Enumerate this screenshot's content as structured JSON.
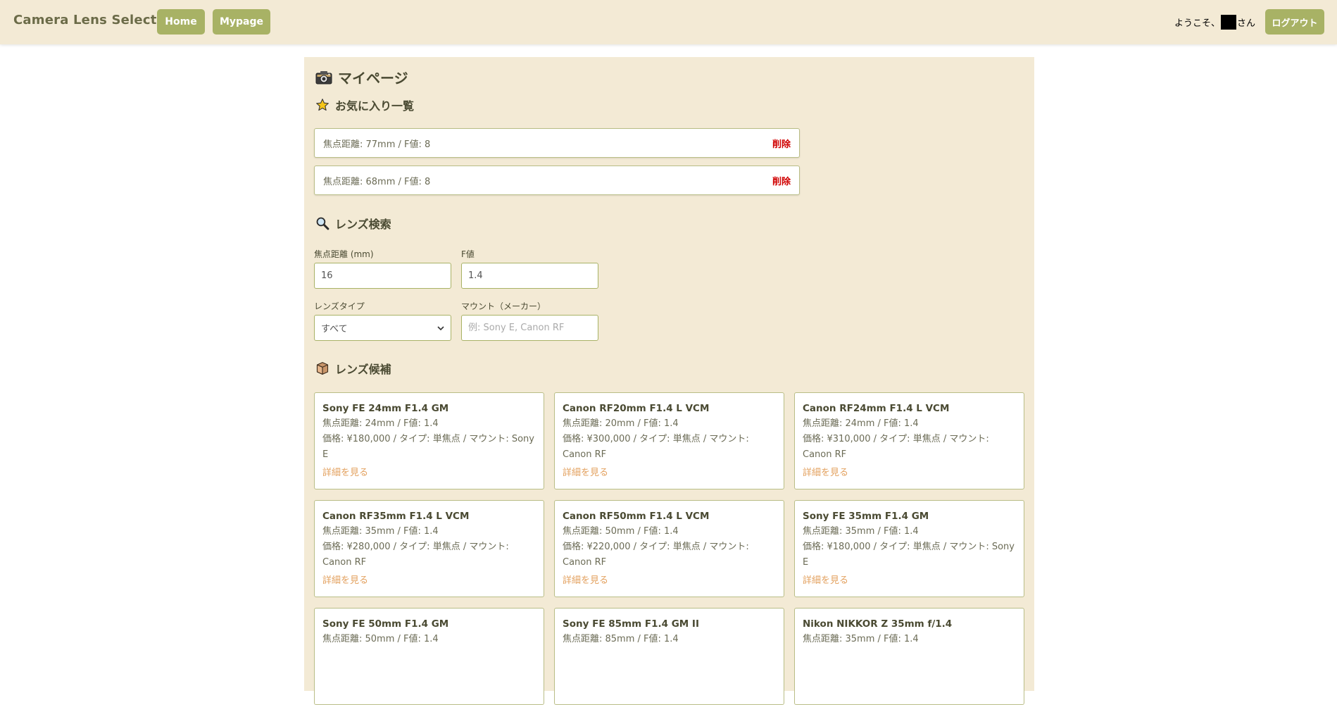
{
  "navbar": {
    "brand": "Camera Lens Selection",
    "home_label": "Home",
    "mypage_label": "Mypage",
    "welcome_prefix": "ようこそ、",
    "welcome_suffix": "さん",
    "logout_label": "ログアウト"
  },
  "mypage": {
    "title": "マイページ",
    "favorites_heading": "お気に入り一覧",
    "favorites": [
      {
        "text": "焦点距離: 77mm / F値: 8",
        "delete_label": "削除"
      },
      {
        "text": "焦点距離: 68mm / F値: 8",
        "delete_label": "削除"
      }
    ]
  },
  "search": {
    "heading": "レンズ検索",
    "focal_label": "焦点距離 (mm)",
    "focal_value": "16",
    "fvalue_label": "F値",
    "fvalue_value": "1.4",
    "type_label": "レンズタイプ",
    "type_selected": "すべて",
    "mount_label": "マウント（メーカー）",
    "mount_placeholder": "例: Sony E, Canon RF"
  },
  "candidates": {
    "heading": "レンズ候補",
    "detail_label": "詳細を見る",
    "cards": [
      {
        "name": "Sony FE 24mm F1.4 GM",
        "spec": "焦点距離: 24mm / F値: 1.4",
        "info": "価格: ¥180,000 / タイプ: 単焦点 / マウント: Sony E"
      },
      {
        "name": "Canon RF20mm F1.4 L VCM",
        "spec": "焦点距離: 20mm / F値: 1.4",
        "info": "価格: ¥300,000 / タイプ: 単焦点 / マウント: Canon RF"
      },
      {
        "name": "Canon RF24mm F1.4 L VCM",
        "spec": "焦点距離: 24mm / F値: 1.4",
        "info": "価格: ¥310,000 / タイプ: 単焦点 / マウント: Canon RF"
      },
      {
        "name": "Canon RF35mm F1.4 L VCM",
        "spec": "焦点距離: 35mm / F値: 1.4",
        "info": "価格: ¥280,000 / タイプ: 単焦点 / マウント: Canon RF"
      },
      {
        "name": "Canon RF50mm F1.4 L VCM",
        "spec": "焦点距離: 50mm / F値: 1.4",
        "info": "価格: ¥220,000 / タイプ: 単焦点 / マウント: Canon RF"
      },
      {
        "name": "Sony FE 35mm F1.4 GM",
        "spec": "焦点距離: 35mm / F値: 1.4",
        "info": "価格: ¥180,000 / タイプ: 単焦点 / マウント: Sony E"
      },
      {
        "name": "Sony FE 50mm F1.4 GM",
        "spec": "焦点距離: 50mm / F値: 1.4",
        "info": ""
      },
      {
        "name": "Sony FE 85mm F1.4 GM II",
        "spec": "焦点距離: 85mm / F値: 1.4",
        "info": ""
      },
      {
        "name": "Nikon NIKKOR Z 35mm f/1.4",
        "spec": "焦点距離: 35mm / F値: 1.4",
        "info": ""
      }
    ]
  }
}
